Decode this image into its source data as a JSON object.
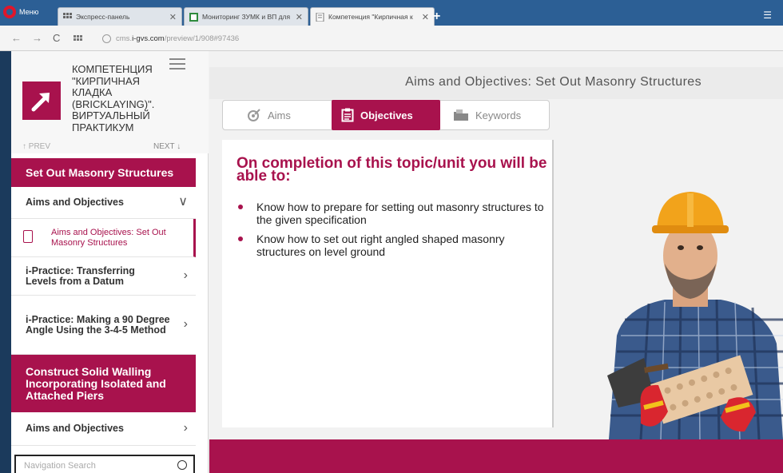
{
  "browser": {
    "menu_label": "Меню",
    "tabs": [
      {
        "label": "Экспресс-панель",
        "close": "✕"
      },
      {
        "label": "Мониторинг ЗУМК и ВП для",
        "close": "✕"
      },
      {
        "label": "Компетенция \"Кирпичная к",
        "close": "✕"
      }
    ],
    "new_tab": "+",
    "tab_menu": "☰",
    "url_prefix": "cms.",
    "url_host": "i-gvs.com",
    "url_path": "/preview/1/908#97436"
  },
  "sidebar": {
    "course_title": "КОМПЕТЕНЦИЯ \"КИРПИЧНАЯ КЛАДКА (BRICKLAYING)\". ВИРТУАЛЬНЫЙ ПРАКТИКУМ",
    "prev_label": "↑ PREV",
    "next_label": "NEXT ↓",
    "section1": "Set Out Masonry Structures",
    "items": [
      {
        "label": "Aims and Objectives",
        "chev": "∨"
      },
      {
        "label": "Aims and Objectives: Set Out Masonry Structures"
      },
      {
        "label": "i-Practice: Transferring Levels from a Datum",
        "chev": "›"
      },
      {
        "label": "i-Practice: Making a 90 Degree Angle Using the 3-4-5 Method",
        "chev": "›"
      }
    ],
    "section2": "Construct Solid Walling Incorporating Isolated and Attached Piers",
    "items2": [
      {
        "label": "Aims and Objectives",
        "chev": "›"
      }
    ],
    "search_placeholder": "Navigation Search"
  },
  "main": {
    "topic_title": "Aims and Objectives: Set Out Masonry Structures",
    "tabs": [
      {
        "label": "Aims"
      },
      {
        "label": "Objectives"
      },
      {
        "label": "Keywords"
      }
    ],
    "headline": "On completion of this topic/unit you will be able to:",
    "objectives": [
      "Know how to prepare for setting out masonry structures to the given specification",
      "Know how to set out right angled shaped masonry structures on level ground"
    ]
  },
  "colors": {
    "accent": "#a8124d",
    "browser_bar": "#2c5f95"
  }
}
